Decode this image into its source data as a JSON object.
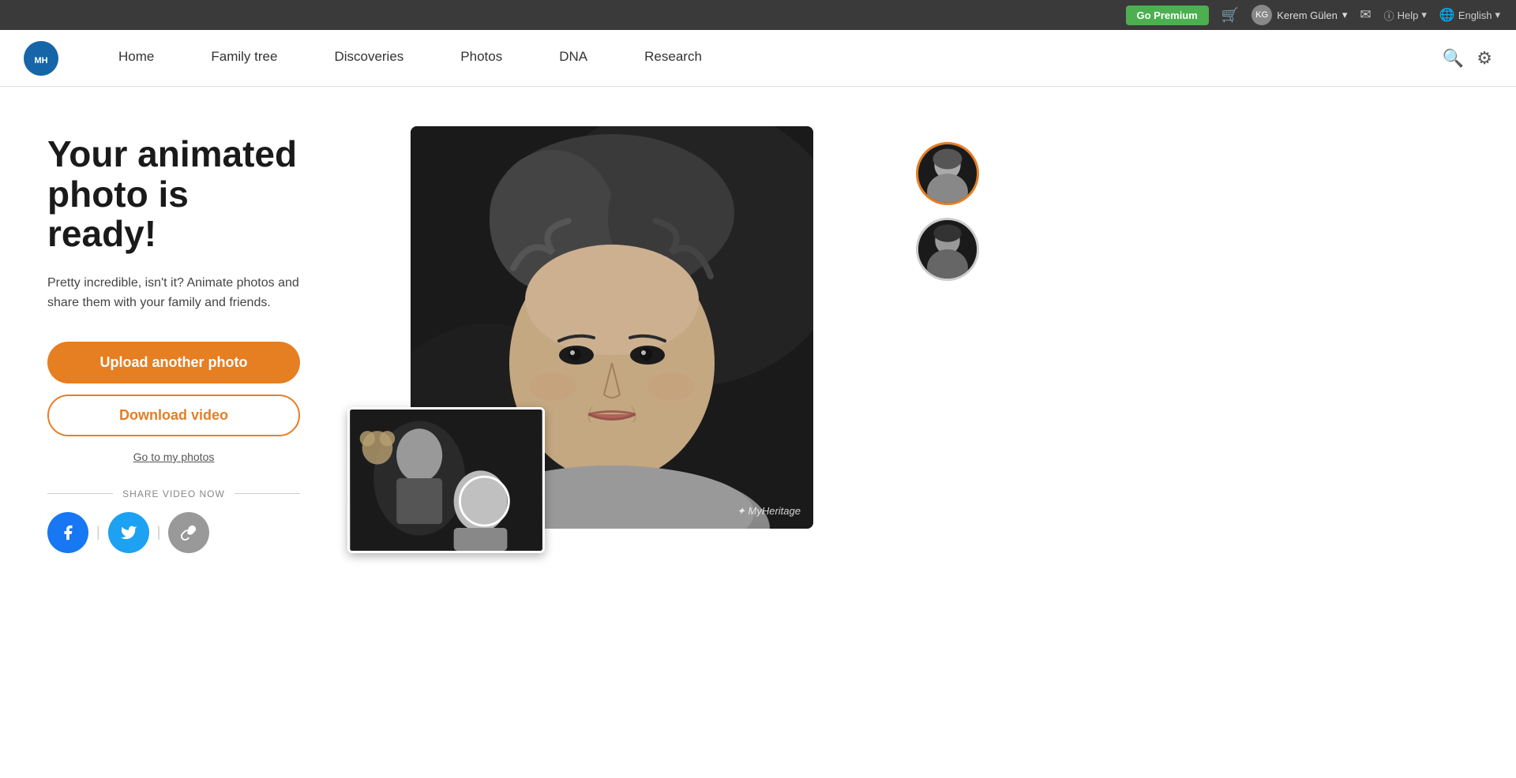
{
  "topbar": {
    "premium_label": "Go Premium",
    "username": "Kerem Gülen",
    "help_label": "Help",
    "language": "English"
  },
  "nav": {
    "logo_text": "MyHeritage",
    "links": [
      {
        "id": "home",
        "label": "Home"
      },
      {
        "id": "family-tree",
        "label": "Family tree"
      },
      {
        "id": "discoveries",
        "label": "Discoveries"
      },
      {
        "id": "photos",
        "label": "Photos"
      },
      {
        "id": "dna",
        "label": "DNA"
      },
      {
        "id": "research",
        "label": "Research"
      }
    ]
  },
  "main": {
    "title_line1": "Your animated",
    "title_line2": "photo is ready!",
    "subtitle": "Pretty incredible, isn't it? Animate photos and share them with your family and friends.",
    "upload_btn": "Upload another photo",
    "download_btn": "Download video",
    "my_photos_link": "Go to my photos",
    "share_label": "SHARE VIDEO NOW",
    "watermark": "✦ MyHeritage"
  }
}
